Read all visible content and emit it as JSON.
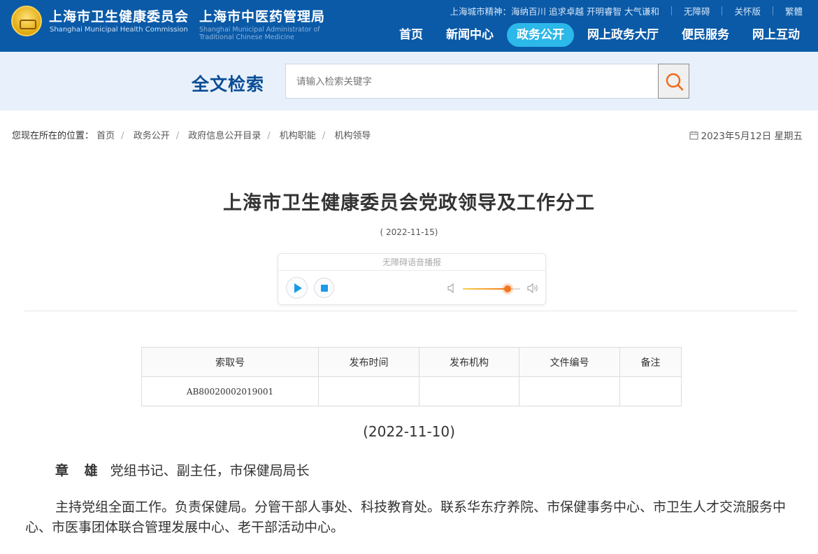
{
  "header": {
    "org1": "上海市卫生健康委员会",
    "org1_en": "Shanghai Municipal Health Commission",
    "org2": "上海市中医药管理局",
    "org2_en": "Shanghai Municipal Administrator of Traditional Chinese Medicine",
    "top_links": {
      "spirit": "上海城市精神：海纳百川 追求卓越 开明睿智 大气谦和",
      "accessible": "无障碍",
      "care": "关怀版",
      "traditional": "繁體"
    },
    "nav": [
      "首页",
      "新闻中心",
      "政务公开",
      "网上政务大厅",
      "便民服务",
      "网上互动"
    ],
    "nav_active": "政务公开"
  },
  "search": {
    "title": "全文检索",
    "placeholder": "请输入检索关键字"
  },
  "breadcrumb": {
    "label": "您现在所在的位置：",
    "items": [
      "首页",
      "政务公开",
      "政府信息公开目录",
      "机构职能",
      "机构领导"
    ]
  },
  "date_display": "2023年5月12日 星期五",
  "article": {
    "title": "上海市卫生健康委员会党政领导及工作分工",
    "date": "( 2022-11-15)",
    "player_title": "无障碍语音播报",
    "volume_level": 0.78,
    "meta_table": {
      "headers": [
        "索取号",
        "发布时间",
        "发布机构",
        "文件编号",
        "备注"
      ],
      "row": [
        "AB80020002019001",
        "",
        "",
        "",
        ""
      ]
    },
    "pub_date": "(2022-11-10)",
    "person_name": "章 雄",
    "person_title": "党组书记、副主任，市保健局局长",
    "duty": "主持党组全面工作。负责保健局。分管干部人事处、科技教育处。联系华东疗养院、市保健事务中心、市卫生人才交流服务中心、市医事团体联合管理发展中心、老干部活动中心。"
  },
  "colors": {
    "header_bg": "#0a5aa8",
    "nav_active_bg": "#2cb8e8",
    "search_band_bg": "#e8f1fb",
    "search_title": "#0a4d96",
    "accent_orange": "#f2761e"
  }
}
